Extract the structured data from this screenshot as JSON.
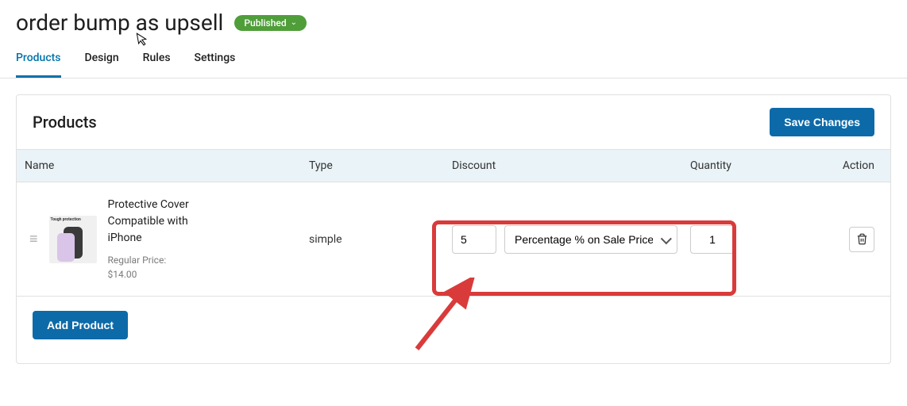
{
  "page": {
    "title": "order bump as upsell",
    "status_label": "Published"
  },
  "tabs": [
    {
      "label": "Products",
      "active": true
    },
    {
      "label": "Design",
      "active": false
    },
    {
      "label": "Rules",
      "active": false
    },
    {
      "label": "Settings",
      "active": false
    }
  ],
  "panel": {
    "title": "Products",
    "save_label": "Save Changes",
    "add_label": "Add Product"
  },
  "columns": {
    "name": "Name",
    "type": "Type",
    "discount": "Discount",
    "quantity": "Quantity",
    "action": "Action"
  },
  "rows": [
    {
      "thumb_caption": "Tough protection",
      "name": "Protective Cover Compatible with iPhone",
      "regular_price_label": "Regular Price:",
      "regular_price": "$14.00",
      "type": "simple",
      "discount_value": "5",
      "discount_type": "Percentage % on Sale Price",
      "quantity": "1"
    }
  ]
}
